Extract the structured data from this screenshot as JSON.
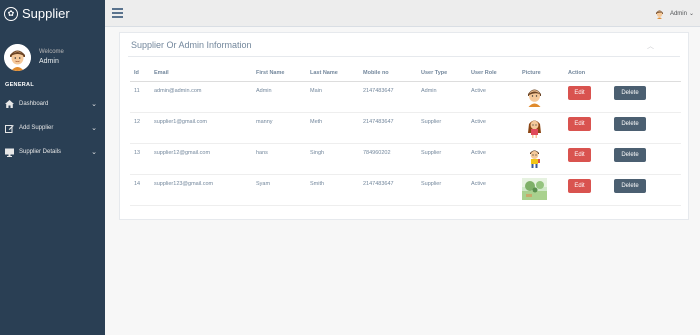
{
  "sidebar": {
    "brand": "Supplier",
    "welcome": "Welcome",
    "user_name": "Admin",
    "section": "GENERAL",
    "items": [
      {
        "label": "Dashboard",
        "icon": "home-icon"
      },
      {
        "label": "Add Supplier",
        "icon": "edit-icon"
      },
      {
        "label": "Supplier Details",
        "icon": "desktop-icon"
      }
    ]
  },
  "topnav": {
    "user": "Admin"
  },
  "panel": {
    "title": "Supplier Or Admin Information"
  },
  "table": {
    "headers": [
      "Id",
      "Email",
      "First Name",
      "Last Name",
      "Mobile no",
      "User Type",
      "User Role",
      "Picture",
      "Action"
    ],
    "rows": [
      {
        "id": "11",
        "email": "admin@admin.com",
        "first": "Admin",
        "last": "Main",
        "mobile": "2147483647",
        "type": "Admin",
        "role": "Active",
        "picture": "boy-avatar"
      },
      {
        "id": "12",
        "email": "supplier1@gmail.com",
        "first": "mannу",
        "last": "Meth",
        "mobile": "2147483647",
        "type": "Supplier",
        "role": "Active",
        "picture": "girl-avatar"
      },
      {
        "id": "13",
        "email": "supplier12@gmail.com",
        "first": "hans",
        "last": "Singh",
        "mobile": "784960202",
        "type": "Supplier",
        "role": "Active",
        "picture": "kid-avatar"
      },
      {
        "id": "14",
        "email": "supplier123@gmail.com",
        "first": "Syam",
        "last": "Smith",
        "mobile": "2147483647",
        "type": "Supplier",
        "role": "Active",
        "picture": "landscape-photo"
      }
    ],
    "edit_label": "Edit",
    "delete_label": "Delete"
  },
  "colors": {
    "sidebar": "#2a3f54",
    "edit": "#d9534f",
    "delete": "#4b5f71"
  }
}
